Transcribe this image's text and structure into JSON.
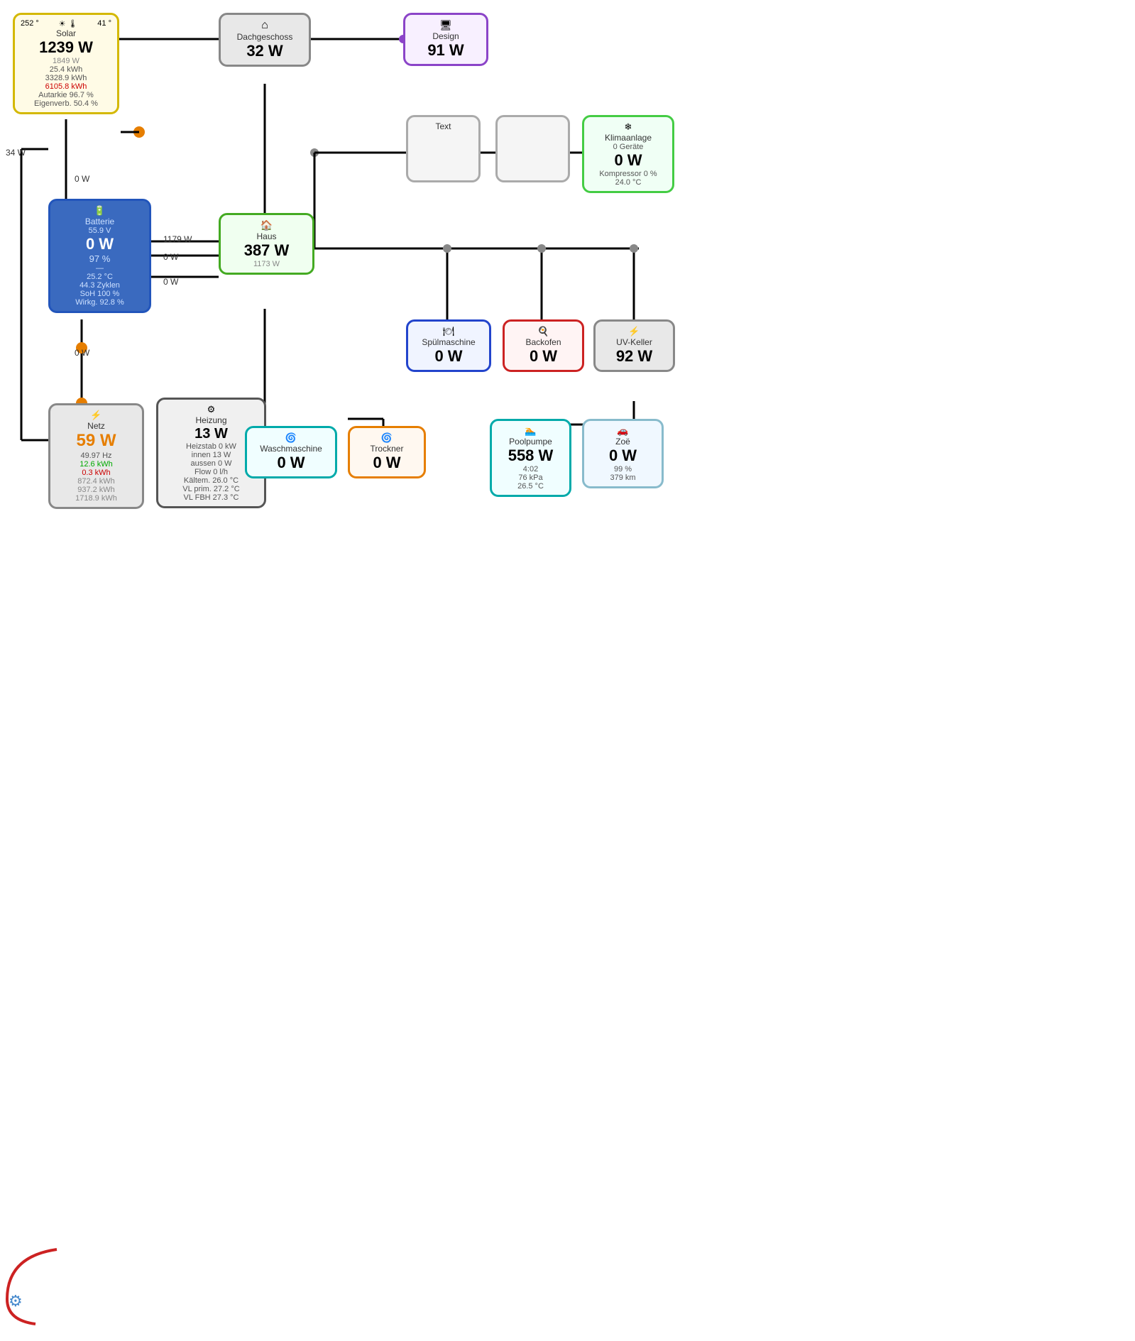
{
  "solar": {
    "title": "Solar",
    "temp": "252 °",
    "icon_sun": "☀",
    "degrees": "41 °",
    "power": "1239 W",
    "sub1": "1849 W",
    "sub2": "25.4 kWh",
    "sub3": "3328.9 kWh",
    "sub4": "6105.8 kWh",
    "sub5": "Autarkie 96.7 %",
    "sub6": "Eigenverb. 50.4 %"
  },
  "dach": {
    "title": "Dachgeschoss",
    "power": "32 W"
  },
  "design": {
    "title": "Design",
    "power": "91 W"
  },
  "batterie": {
    "title": "Batterie",
    "voltage": "55.9 V",
    "power": "0 W",
    "percent": "97 %",
    "dash": "—",
    "temp": "25.2 °C",
    "zyklen": "44.3 Zyklen",
    "soh": "SoH 100 %",
    "wirkg": "Wirkg. 92.8 %"
  },
  "haus": {
    "title": "Haus",
    "power": "387 W",
    "sub": "1173 W"
  },
  "text_node": {
    "title": "Text"
  },
  "klima": {
    "title": "Klimaanlage",
    "geraete": "0 Geräte",
    "power": "0 W",
    "kompressor": "Kompressor 0 %",
    "temp": "24.0 °C"
  },
  "netz": {
    "title": "Netz",
    "power": "59 W",
    "freq": "49.97 Hz",
    "kwh1": "12.6 kWh",
    "kwh2": "0.3 kWh",
    "kwh3": "872.4 kWh",
    "kwh4": "937.2 kWh",
    "kwh5": "1718.9 kWh"
  },
  "heizung": {
    "title": "Heizung",
    "power": "13 W",
    "heizstab": "Heizstab 0 kW",
    "innen": "innen 13 W",
    "aussen": "aussen 0 W",
    "flow": "Flow 0 l/h",
    "kaltem": "Kältem. 26.0 °C",
    "vl_prim": "VL prim. 27.2 °C",
    "vl_fbh": "VL FBH 27.3 °C"
  },
  "waschmaschine": {
    "title": "Waschmaschine",
    "power": "0 W"
  },
  "trockner": {
    "title": "Trockner",
    "power": "0 W"
  },
  "spuelmaschine": {
    "title": "Spülmaschine",
    "power": "0 W"
  },
  "backofen": {
    "title": "Backofen",
    "power": "0 W"
  },
  "uvkeller": {
    "title": "UV-Keller",
    "power": "92 W"
  },
  "poolpumpe": {
    "title": "Poolpumpe",
    "power": "558 W",
    "time": "4:02",
    "pressure": "76 kPa",
    "temp": "26.5 °C"
  },
  "zoe": {
    "title": "Zoë",
    "power": "0 W",
    "percent": "99 %",
    "km": "379 km"
  },
  "labels": {
    "w34": "34 W",
    "w0_left": "0 W",
    "w0_mid": "0 W",
    "w0_right": "0 W",
    "w1179": "1179 W"
  }
}
